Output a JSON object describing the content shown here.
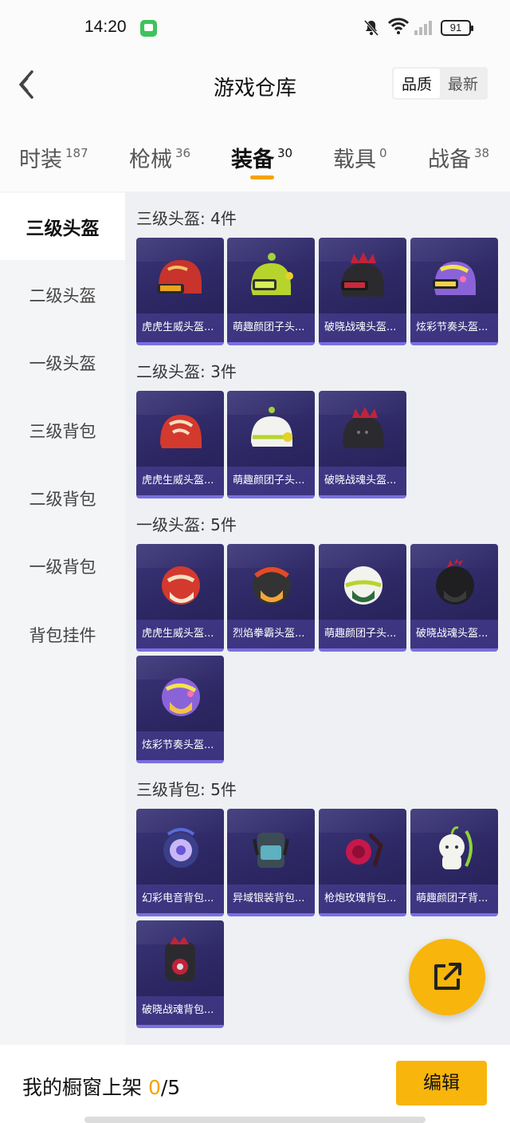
{
  "status_bar": {
    "time": "14:20",
    "battery": "91"
  },
  "header": {
    "title": "游戏仓库",
    "sort_options": [
      "品质",
      "最新"
    ]
  },
  "tabs": [
    {
      "label": "时装",
      "count": "187"
    },
    {
      "label": "枪械",
      "count": "36"
    },
    {
      "label": "装备",
      "count": "30"
    },
    {
      "label": "载具",
      "count": "0"
    },
    {
      "label": "战备",
      "count": "38"
    }
  ],
  "sidebar": [
    "三级头盔",
    "二级头盔",
    "一级头盔",
    "三级背包",
    "二级背包",
    "一级背包",
    "背包挂件"
  ],
  "sections": [
    {
      "title": "三级头盔: 4件",
      "items": [
        "虎虎生威头盔...",
        "萌趣颜团子头...",
        "破晓战魂头盔...",
        "炫彩节奏头盔..."
      ]
    },
    {
      "title": "二级头盔: 3件",
      "items": [
        "虎虎生威头盔...",
        "萌趣颜团子头...",
        "破晓战魂头盔..."
      ]
    },
    {
      "title": "一级头盔: 5件",
      "items": [
        "虎虎生威头盔...",
        "烈焰拳霸头盔...",
        "萌趣颜团子头...",
        "破晓战魂头盔...",
        "炫彩节奏头盔..."
      ]
    },
    {
      "title": "三级背包: 5件",
      "items": [
        "幻彩电音背包...",
        "异域银装背包...",
        "枪炮玫瑰背包...",
        "萌趣颜团子背...",
        "破晓战魂背包..."
      ]
    }
  ],
  "bottom_bar": {
    "label": "我的橱窗上架 ",
    "count": "0",
    "total": "/5",
    "edit_label": "编辑"
  },
  "colors": {
    "accent": "#f8b50b",
    "card_bg": "#2c2762",
    "card_border": "#7a6fe0"
  },
  "icons": {
    "back": "back-chevron-icon",
    "fab": "share-icon",
    "status": [
      "message-icon",
      "bell-off-icon",
      "wifi-icon",
      "signal-icon",
      "battery-icon"
    ]
  }
}
